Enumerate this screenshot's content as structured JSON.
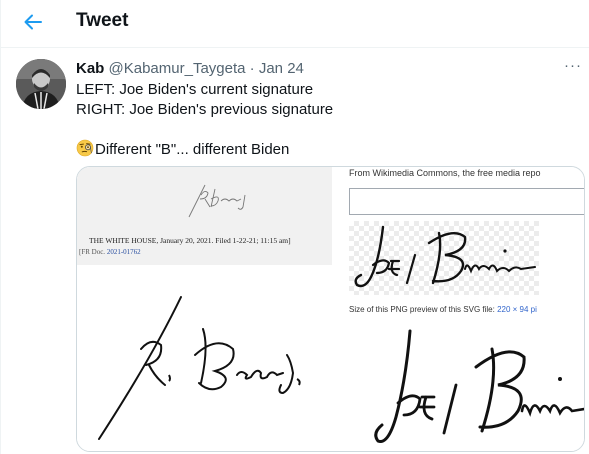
{
  "header": {
    "title": "Tweet"
  },
  "tweet": {
    "author_name": "Kab",
    "handle": "@Kabamur_Taygeta",
    "separator": "·",
    "date": "Jan 24",
    "more_label": "···",
    "lines": [
      "LEFT: Joe Biden's current signature",
      "RIGHT: Joe Biden's previous signature"
    ],
    "emoji_line_text": "Different \"B\"... different Biden",
    "emoji": "monocle-face"
  },
  "media": {
    "left": {
      "doc_line": "THE WHITE HOUSE, January 20, 2021. Filed 1-22-21; 11:15 am]",
      "doc_ref_prefix": "[FR Doc. ",
      "doc_ref_link": "2021-01762"
    },
    "right": {
      "wiki_header": "From Wikimedia Commons, the free media repo",
      "size_prefix": "Size of this PNG preview of this SVG file: ",
      "size_link": "220 × 94 pi"
    }
  },
  "colors": {
    "accent": "#1d9bf0",
    "text": "#0f1419",
    "secondary": "#536471",
    "border": "#cfd9de"
  }
}
